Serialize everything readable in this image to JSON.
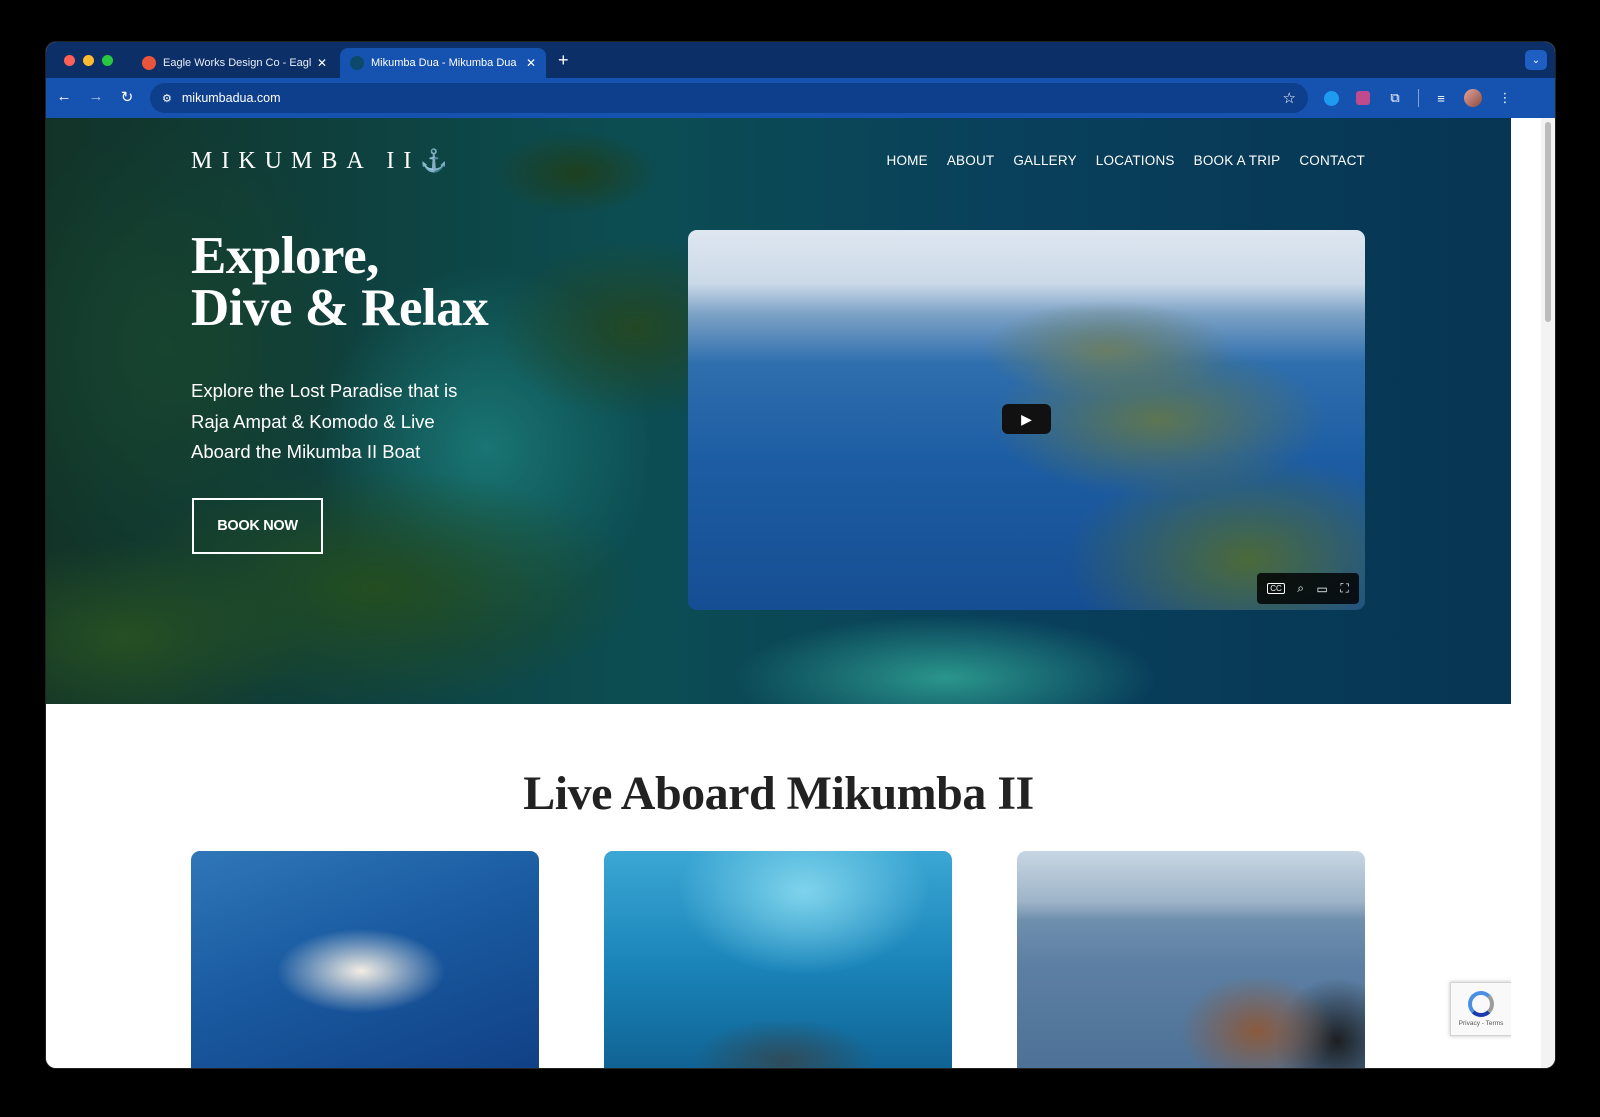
{
  "browser": {
    "tabs": [
      {
        "title": "Eagle Works Design Co - Eagl",
        "favicon_color": "#e8543c",
        "active": false
      },
      {
        "title": "Mikumba Dua - Mikumba Dua",
        "favicon_color": "#0b4a6a",
        "active": true
      }
    ],
    "new_tab": "+",
    "tab_close": "✕",
    "url": "mikumbadua.com"
  },
  "site": {
    "logo": "MIKUMBA II",
    "logo_anchor": "⚓",
    "nav": [
      "HOME",
      "ABOUT",
      "GALLERY",
      "LOCATIONS",
      "BOOK A TRIP",
      "CONTACT"
    ]
  },
  "hero": {
    "heading_line1": "Explore,",
    "heading_line2": "Dive & Relax",
    "subtext": "Explore the Lost Paradise that is Raja Ampat & Komodo & Live Aboard the Mikumba II Boat",
    "cta": "BOOK NOW"
  },
  "video": {
    "play_icon": "▶",
    "controls": [
      "CC",
      "⌕",
      "cast",
      "⛶"
    ]
  },
  "section": {
    "title": "Live Aboard Mikumba II"
  },
  "cards": [
    {
      "name": "boat"
    },
    {
      "name": "diver"
    },
    {
      "name": "relax"
    }
  ],
  "recaptcha": {
    "text": "Privacy - Terms"
  },
  "colors": {
    "tab_strip": "#0b2f66",
    "toolbar": "#1652b0",
    "heading_text": "#222222"
  }
}
